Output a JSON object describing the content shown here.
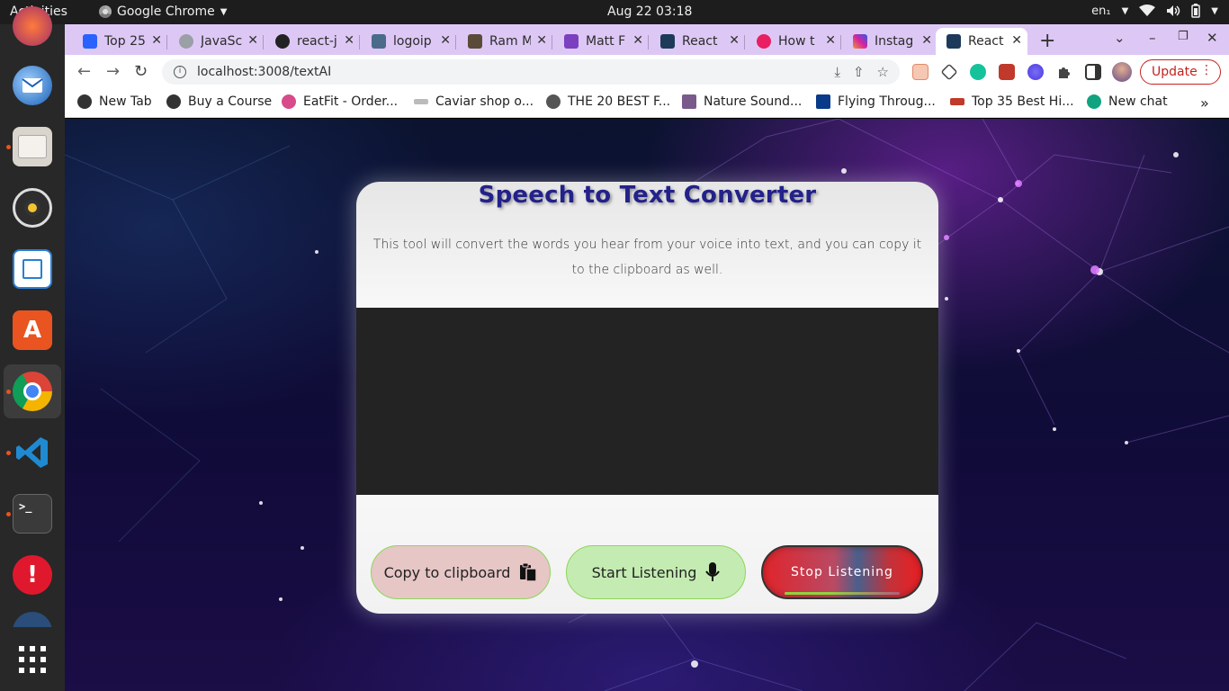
{
  "topbar": {
    "activities": "Activities",
    "app_name": "Google Chrome",
    "clock": "Aug 22  03:18",
    "lang": "en₁"
  },
  "dock": {
    "items": [
      "thunderbird-mail",
      "files",
      "rhythmbox",
      "libreoffice-writer",
      "ubuntu-software",
      "google-chrome",
      "vscode",
      "terminal",
      "software-updater",
      "show-apps"
    ]
  },
  "tabs": [
    {
      "title": "Top 25",
      "fav": "#2962ff"
    },
    {
      "title": "JavaSc",
      "fav": "#9aa0a6"
    },
    {
      "title": "react-j",
      "fav": "#222222"
    },
    {
      "title": "logoip",
      "fav": "#4a6b8a"
    },
    {
      "title": "Ram M",
      "fav": "#5a4a3a"
    },
    {
      "title": "Matt F",
      "fav": "#7b3fbf"
    },
    {
      "title": "React",
      "fav": "#1d3a5a"
    },
    {
      "title": "How t",
      "fav": "#e91e63"
    },
    {
      "title": "Instag",
      "fav": "#d6249f"
    },
    {
      "title": "React",
      "fav": "#1d3a5a"
    }
  ],
  "toolbar": {
    "url": "localhost:3008/textAI",
    "update_label": "Update"
  },
  "bookmarks": [
    "New Tab",
    "Buy a Course",
    "EatFit - Order...",
    "Caviar shop o...",
    "THE 20 BEST F...",
    "Nature Sound...",
    "Flying Throug...",
    "Top 35 Best Hi...",
    "New chat"
  ],
  "app": {
    "title": "Speech to Text Converter",
    "description": "This tool will convert the words you hear from your voice into text, and you can copy it to the clipboard as well.",
    "transcript": "",
    "copy_label": "Copy to clipboard",
    "start_label": "Start Listening",
    "stop_label": "Stop Listening"
  },
  "colors": {
    "title": "#23218a",
    "tabstrip": "#ddc8f5",
    "update": "#c5221f",
    "start_bg": "#c4ecb2",
    "copy_bg": "#e7c6c6",
    "stop_red": "#e0242b"
  }
}
